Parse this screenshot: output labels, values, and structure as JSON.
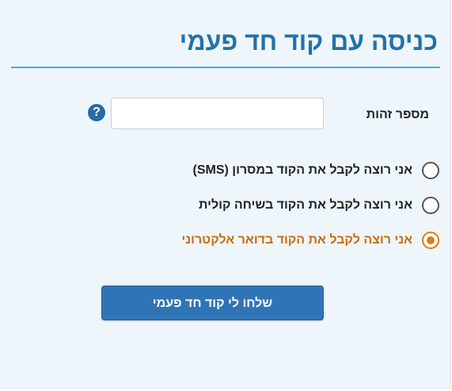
{
  "title": "כניסה עם קוד חד פעמי",
  "id_field": {
    "label": "מספר זהות",
    "value": "",
    "placeholder": "",
    "help_icon": "question-circle-icon",
    "help_glyph": "?"
  },
  "delivery_options": [
    {
      "label": "אני רוצה לקבל את הקוד במסרון (SMS)",
      "selected": false
    },
    {
      "label": "אני רוצה לקבל את הקוד בשיחה קולית",
      "selected": false
    },
    {
      "label": "אני רוצה לקבל את הקוד בדואר אלקטרוני",
      "selected": true
    }
  ],
  "submit_label": "שלחו לי קוד חד פעמי",
  "colors": {
    "title": "#2372a8",
    "rule": "#3ab4e3",
    "panel_bg": "#eef6fb",
    "button_bg": "#2f74b5",
    "selected_accent": "#e07b16",
    "selected_text": "#cc6a10"
  }
}
